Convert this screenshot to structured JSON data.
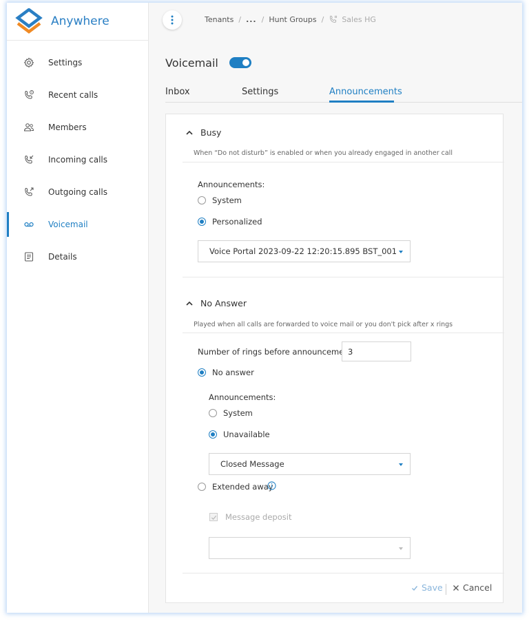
{
  "brand": {
    "name": "Anywhere"
  },
  "sidebar": {
    "items": [
      {
        "label": "Settings",
        "icon": "gear-icon"
      },
      {
        "label": "Recent calls",
        "icon": "phone-clock-icon"
      },
      {
        "label": "Members",
        "icon": "people-icon"
      },
      {
        "label": "Incoming calls",
        "icon": "phone-incoming-icon"
      },
      {
        "label": "Outgoing calls",
        "icon": "phone-outgoing-icon"
      },
      {
        "label": "Voicemail",
        "icon": "voicemail-icon"
      },
      {
        "label": "Details",
        "icon": "document-icon"
      }
    ],
    "active_label": "Voicemail"
  },
  "breadcrumb": {
    "items": [
      "Tenants",
      "...",
      "Hunt Groups",
      "Sales HG"
    ]
  },
  "header": {
    "title": "Voicemail",
    "toggle_on": true
  },
  "tabs": [
    {
      "label": "Inbox"
    },
    {
      "label": "Settings"
    },
    {
      "label": "Announcements"
    }
  ],
  "active_tab": "Announcements",
  "busy": {
    "title": "Busy",
    "description": "When “Do not disturb” is enabled or when you already engaged in another call",
    "announcements_label": "Announcements:",
    "options": [
      "System",
      "Personalized"
    ],
    "selected": "Personalized",
    "select_value": "Voice Portal 2023-09-22 12:20:15.895 BST_001"
  },
  "no_answer": {
    "title": "No Answer",
    "description": "Played when all calls are forwarded to voice mail or you don't pick after x rings",
    "rings_label": "Number of rings before announcements",
    "rings_value": "3",
    "no_answer_label": "No answer",
    "announcements_label": "Announcements:",
    "options": [
      "System",
      "Unavailable"
    ],
    "selected": "Unavailable",
    "select_value": "Closed Message",
    "extended_away_label": "Extended away",
    "message_deposit_label": "Message deposit",
    "extended_select_value": ""
  },
  "footer": {
    "save_label": "Save",
    "cancel_label": "Cancel"
  },
  "colors": {
    "accent": "#1f7fc3",
    "brand_orange": "#f08a24",
    "brand_blue": "#2a7fc4"
  }
}
